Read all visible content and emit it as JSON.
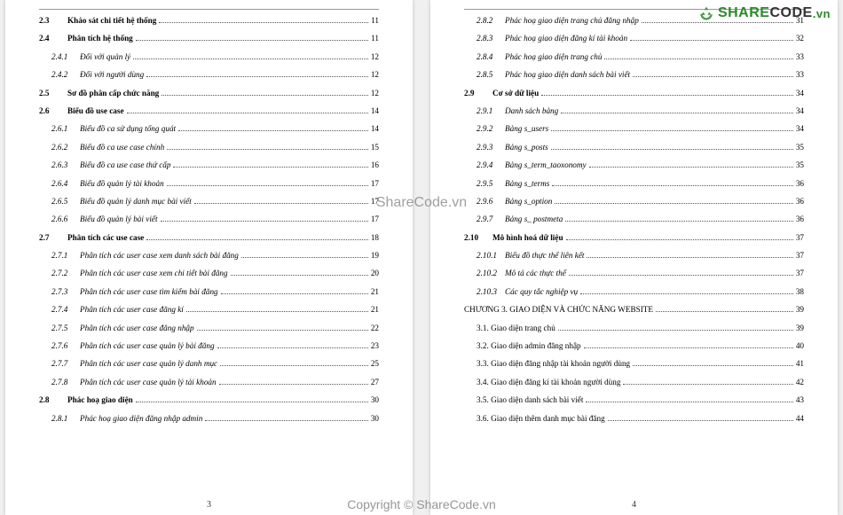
{
  "brand": {
    "share": "SHARE",
    "code": "CODE",
    "vn": ".vn"
  },
  "watermark_center": "ShareCode.vn",
  "watermark_bottom": "Copyright © ShareCode.vn",
  "page_left_num": "3",
  "page_right_num": "4",
  "left": [
    {
      "num": "2.3",
      "text": "Khảo sát chi tiết hệ thống",
      "pg": "11",
      "bold": true,
      "lvl": 0
    },
    {
      "num": "2.4",
      "text": "Phân tích hệ thống",
      "pg": "11",
      "bold": true,
      "lvl": 0
    },
    {
      "num": "2.4.1",
      "text": "Đối với quản lý",
      "pg": "12",
      "italic": true,
      "lvl": 1
    },
    {
      "num": "2.4.2",
      "text": "Đối với người dùng",
      "pg": "12",
      "italic": true,
      "lvl": 1
    },
    {
      "num": "2.5",
      "text": "Sơ đồ phân cấp chức năng",
      "pg": "12",
      "bold": true,
      "lvl": 0
    },
    {
      "num": "2.6",
      "text": "Biểu đồ use case",
      "pg": "14",
      "bold": true,
      "lvl": 0
    },
    {
      "num": "2.6.1",
      "text": "Biểu đồ ca sử dụng tổng quát",
      "pg": "14",
      "italic": true,
      "lvl": 1
    },
    {
      "num": "2.6.2",
      "text": "Biểu đồ ca use case chính",
      "pg": "15",
      "italic": true,
      "lvl": 1
    },
    {
      "num": "2.6.3",
      "text": "Biểu đồ ca use case thứ cấp",
      "pg": "16",
      "italic": true,
      "lvl": 1
    },
    {
      "num": "2.6.4",
      "text": "Biểu đồ quản lý tài khoản",
      "pg": "17",
      "italic": true,
      "lvl": 1
    },
    {
      "num": "2.6.5",
      "text": "Biểu đồ quản lý danh mục bài viết",
      "pg": "17",
      "italic": true,
      "lvl": 1
    },
    {
      "num": "2.6.6",
      "text": "Biểu đồ quản lý bài viết",
      "pg": "17",
      "italic": true,
      "lvl": 1
    },
    {
      "num": "2.7",
      "text": "Phân tích các use case",
      "pg": "18",
      "bold": true,
      "lvl": 0
    },
    {
      "num": "2.7.1",
      "text": "Phân tích các user case xem danh sách bài đăng",
      "pg": "19",
      "italic": true,
      "lvl": 1
    },
    {
      "num": "2.7.2",
      "text": "Phân tích các user case xem chi tiết bài đăng",
      "pg": "20",
      "italic": true,
      "lvl": 1
    },
    {
      "num": "2.7.3",
      "text": "Phân tích các user case tìm kiếm bài đăng",
      "pg": "21",
      "italic": true,
      "lvl": 1
    },
    {
      "num": "2.7.4",
      "text": "Phân tích các user case đăng kí",
      "pg": "21",
      "italic": true,
      "lvl": 1
    },
    {
      "num": "2.7.5",
      "text": "Phân tích các user case đăng nhập",
      "pg": "22",
      "italic": true,
      "lvl": 1
    },
    {
      "num": "2.7.6",
      "text": "Phân tích các user case quản lý bài đăng",
      "pg": "23",
      "italic": true,
      "lvl": 1
    },
    {
      "num": "2.7.7",
      "text": "Phân tích các user case quản lý danh mục",
      "pg": "25",
      "italic": true,
      "lvl": 1
    },
    {
      "num": "2.7.8",
      "text": "Phân tích các user case quản lý tài khoản",
      "pg": "27",
      "italic": true,
      "lvl": 1
    },
    {
      "num": "2.8",
      "text": "Phác hoạ giao diện",
      "pg": "30",
      "bold": true,
      "lvl": 0
    },
    {
      "num": "2.8.1",
      "text": "Phác hoạ giao diện đăng nhập admin",
      "pg": "30",
      "italic": true,
      "lvl": 1
    }
  ],
  "right": [
    {
      "num": "2.8.2",
      "text": "Phác hoạ giao diện trang chủ đăng nhập",
      "pg": "31",
      "italic": true,
      "lvl": 1
    },
    {
      "num": "2.8.3",
      "text": "Phác hoạ giao diện đăng kí tài khoản",
      "pg": "32",
      "italic": true,
      "lvl": 1
    },
    {
      "num": "2.8.4",
      "text": "Phác hoạ giao diện trang chủ",
      "pg": "33",
      "italic": true,
      "lvl": 1
    },
    {
      "num": "2.8.5",
      "text": "Phác hoạ giao diện danh sách bài viết",
      "pg": "33",
      "italic": true,
      "lvl": 1
    },
    {
      "num": "2.9",
      "text": "Cơ sở dữ liệu",
      "pg": "34",
      "bold": true,
      "lvl": 0
    },
    {
      "num": "2.9.1",
      "text": "Danh sách bảng",
      "pg": "34",
      "italic": true,
      "lvl": 1
    },
    {
      "num": "2.9.2",
      "text": "Bảng s_users",
      "pg": "34",
      "italic": true,
      "lvl": 1
    },
    {
      "num": "2.9.3",
      "text": "Bảng s_posts",
      "pg": "35",
      "italic": true,
      "lvl": 1
    },
    {
      "num": "2.9.4",
      "text": "Bảng s_term_taoxonomy",
      "pg": "35",
      "italic": true,
      "lvl": 1
    },
    {
      "num": "2.9.5",
      "text": "Bảng s_terms",
      "pg": "36",
      "italic": true,
      "lvl": 1
    },
    {
      "num": "2.9.6",
      "text": "Bảng s_option",
      "pg": "36",
      "italic": true,
      "lvl": 1
    },
    {
      "num": "2.9.7",
      "text": "Bảng s_ postmeta",
      "pg": "36",
      "italic": true,
      "lvl": 1
    },
    {
      "num": "2.10",
      "text": "Mô hình hoá dữ liệu",
      "pg": "37",
      "bold": true,
      "lvl": 0
    },
    {
      "num": "2.10.1",
      "text": "Biểu đồ thực thể liên kết",
      "pg": "37",
      "italic": true,
      "lvl": 1
    },
    {
      "num": "2.10.2",
      "text": "Mô tả các thực thể",
      "pg": "37",
      "italic": true,
      "lvl": 1
    },
    {
      "num": "2.10.3",
      "text": "Các quy tắc nghiệp vụ",
      "pg": "38",
      "italic": true,
      "lvl": 1
    },
    {
      "num": "",
      "text": "CHƯƠNG 3. GIAO DIỆN VÀ CHỨC NĂNG WEBSITE",
      "pg": "39",
      "chapter": true,
      "lvl": -1
    },
    {
      "num": "",
      "text": "3.1. Giao diện trang chủ",
      "pg": "39",
      "lvl": 0
    },
    {
      "num": "",
      "text": "3.2. Giao diện admin đăng nhập",
      "pg": "40",
      "lvl": 0
    },
    {
      "num": "",
      "text": "3.3. Giao diện đăng nhập tài khoản người dùng",
      "pg": "41",
      "lvl": 0
    },
    {
      "num": "",
      "text": "3.4. Giao diện đăng kí tài khoản người dùng",
      "pg": "42",
      "lvl": 0
    },
    {
      "num": "",
      "text": "3.5. Giao diện danh sách bài viết",
      "pg": "43",
      "lvl": 0
    },
    {
      "num": "",
      "text": "3.6. Giao diện thêm danh mục bài đăng",
      "pg": "44",
      "lvl": 0
    }
  ]
}
